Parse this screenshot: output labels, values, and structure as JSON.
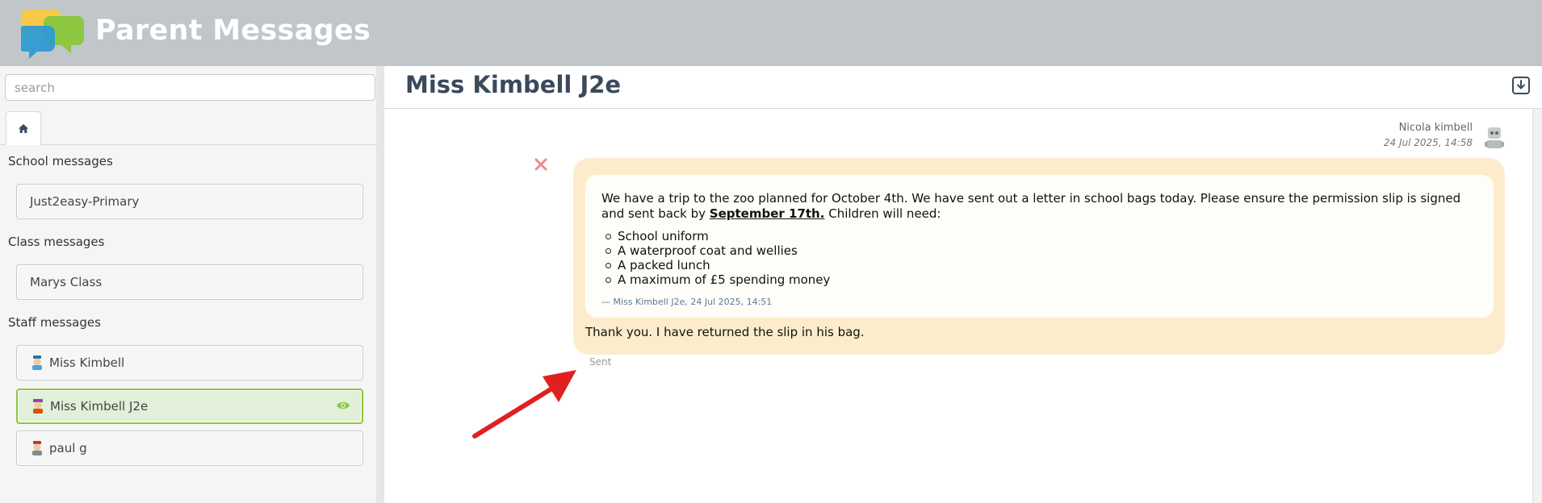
{
  "header": {
    "title": "Parent Messages"
  },
  "sidebar": {
    "search_placeholder": "search",
    "sections": {
      "school": {
        "title": "School messages",
        "items": [
          "Just2easy-Primary"
        ]
      },
      "class": {
        "title": "Class messages",
        "items": [
          "Marys Class"
        ]
      },
      "staff": {
        "title": "Staff messages",
        "items": [
          "Miss Kimbell",
          "Miss Kimbell J2e",
          "paul g"
        ]
      }
    },
    "active_item": "Miss Kimbell J2e"
  },
  "conversation": {
    "title": "Miss Kimbell J2e",
    "message": {
      "sender": "Nicola kimbell",
      "timestamp": "24 Jul 2025, 14:58",
      "quote": {
        "text_before": "We have a trip to the zoo planned for October 4th. We have sent out a letter in school bags today. Please ensure the permission slip is signed and sent back by",
        "date_emphasis": "September 17th.",
        "text_after": " Children will need:",
        "items": [
          "School uniform",
          "A waterproof coat and wellies",
          "A packed lunch",
          "A maximum of £5 spending money"
        ],
        "attribution": "— Miss Kimbell J2e, 24 Jul 2025, 14:51"
      },
      "reply": "Thank you. I have returned the slip in his bag.",
      "status": "Sent"
    }
  },
  "colors": {
    "header_bg": "#c0c6ca",
    "bubble_bg": "#fdeccb",
    "active_item_bg": "#e2efd9",
    "active_item_border": "#8cc63f",
    "title_text": "#3a4a5c",
    "arrow": "#e02020",
    "close_x": "#f08a8a"
  },
  "icons": {
    "logo": "speech-bubbles-logo",
    "home_tab": "home-icon",
    "eye": "eye-icon",
    "download": "download-icon",
    "close": "close-icon",
    "annotation": "red-arrow"
  }
}
